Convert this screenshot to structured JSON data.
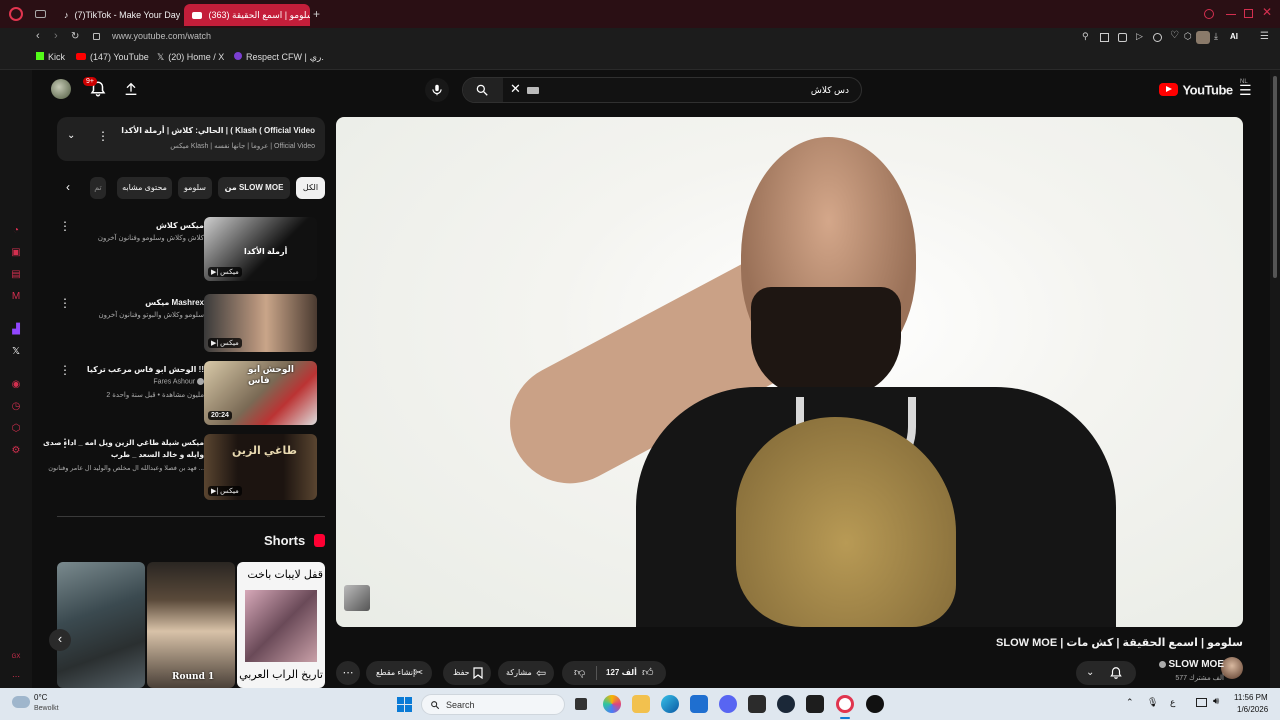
{
  "browser": {
    "tabs": [
      {
        "label": "(7)TikTok - Make Your Day"
      },
      {
        "label": "سلومو | اسمع الحقيقة (363)"
      }
    ],
    "new_tab": "+",
    "url": "www.youtube.com/watch",
    "ai_label": "AI",
    "bookmarks": [
      {
        "label": "Kick"
      },
      {
        "label": "(147) YouTube"
      },
      {
        "label": "(20) Home / X"
      },
      {
        "label": "Respect CFW | ..."
      }
    ],
    "bookmark_tail": "ري."
  },
  "header": {
    "notifications_badge": "9+",
    "search_value": "دس كلاش",
    "logo_text": "YouTube",
    "region": "NL"
  },
  "playlist": {
    "title": "الحالي: كلاش | أرملة الأكدا | ( Klash ( Official Video",
    "subtitle": "ميكس Klash | عروما | جانها نفسه | Official Video"
  },
  "chips": [
    {
      "label": "الكل"
    },
    {
      "label": "من SLOW MOE"
    },
    {
      "label": "سلومو"
    },
    {
      "label": "محتوى مشابه"
    },
    {
      "label": "تم"
    }
  ],
  "recommendations": [
    {
      "title": "ميكس كلاش",
      "sub1": "كلاش وكلاش وسلومو وفنانون آخرون",
      "sub2": "",
      "badge": "ميكس",
      "duration": "",
      "thumb_text": "أرملة الأكدا"
    },
    {
      "title": "ميكس Mashrex",
      "sub1": "سلومو وكلاش والبوتو وفنانون آخرون",
      "sub2": "",
      "badge": "ميكس",
      "duration": "",
      "thumb_text": ""
    },
    {
      "title": "الوحش ابو فاس مرعب تركيا !!",
      "sub1": "Fares Ashour",
      "sub2": "2 مليون مشاهدة • قبل سنة واحدة",
      "badge": "",
      "duration": "20:24",
      "thumb_text": "الوحش ابو فاس"
    },
    {
      "title": "ميكس شيلة طاغي الزين ويل امه _ اداء صدى",
      "sub1": "وايله و خالد السعد _ طرب",
      "sub2": "فهد بن فصلا وعبدالله ال مخلص والوليد ال عامر وفنانون ...",
      "badge": "ميكس",
      "duration": "",
      "thumb_text": "طاغي الزين"
    }
  ],
  "shorts": {
    "heading": "Shorts",
    "items": [
      {
        "text": ""
      },
      {
        "text": "Round 1"
      },
      {
        "text_top": "قفل لايبات باخت",
        "text_bottom": "تاريخ الراب العربي"
      }
    ]
  },
  "video": {
    "title": "سلومو | اسمع الحقيقة | كش مات | SLOW MOE",
    "channel": "SLOW MOE",
    "subscribers": "577 ألف مشترك",
    "likes": "127 ألف",
    "share_label": "مشاركة",
    "save_label": "حفظ",
    "clip_label": "إنشاء مقطع"
  },
  "taskbar": {
    "weather_temp": "0°C",
    "weather_desc": "Bewolkt",
    "search_placeholder": "Search",
    "time": "11:56 PM",
    "date": "1/6/2026",
    "lang": "ع"
  },
  "colors": {
    "accent": "#ff0000",
    "opera_red": "#d32f4f",
    "bg": "#0f0f0f",
    "chip_bg": "#272727"
  }
}
